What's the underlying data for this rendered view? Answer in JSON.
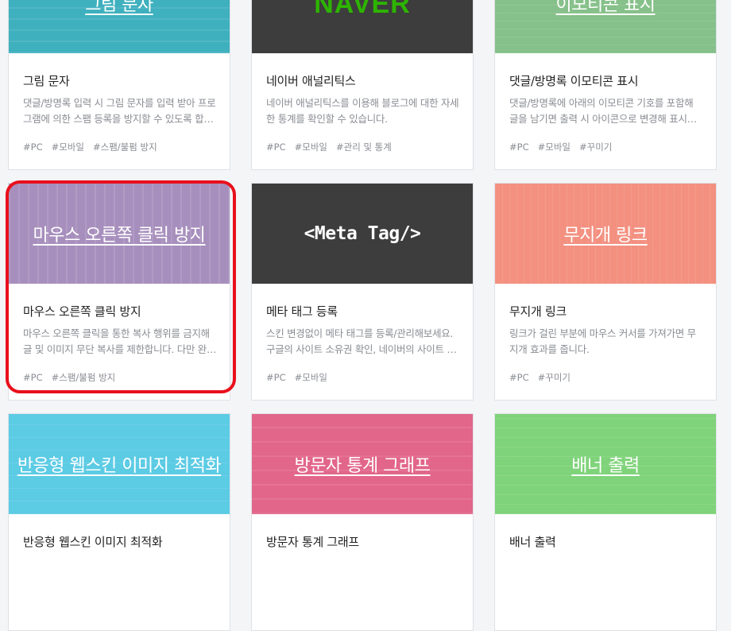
{
  "colors": {
    "highlight": "#e8101c",
    "naver_green": "#2db400"
  },
  "cards": [
    {
      "thumb_label": "그림 문자",
      "thumb_color": "#3fb0be",
      "title": "그림 문자",
      "desc": "댓글/방명록 입력 시 그림 문자를 입력 받아 프로그램에 의한 스팸 등록을 방지할 수 있도록 합니다.",
      "tags": [
        "#PC",
        "#모바일",
        "#스팸/불펌 방지"
      ]
    },
    {
      "thumb_label": "NAVER",
      "thumb_color": "#3d3d3d",
      "title": "네이버 애널리틱스",
      "desc": "네이버 애널리틱스를 이용해 블로그에 대한 자세한 통계를 확인할 수 있습니다.",
      "tags": [
        "#PC",
        "#모바일",
        "#관리 및 통계"
      ]
    },
    {
      "thumb_label": "이모티콘 표시",
      "thumb_color": "#86c08a",
      "title": "댓글/방명록 이모티콘 표시",
      "desc": "댓글/방명록에 아래의 이모티콘 기호를 포함해 글을 남기면 출력 시 아이콘으로 변경해 표시합니다.",
      "tags": [
        "#PC",
        "#모바일",
        "#꾸미기"
      ]
    },
    {
      "thumb_label": "마우스 오른쪽 클릭 방지",
      "thumb_color": "#a78fbd",
      "title": "마우스 오른쪽 클릭 방지",
      "desc": "마우스 오른쪽 클릭을 통한 복사 행위를 금지해 글 및 이미지 무단 복사를 제한합니다. 다만 완벽한 방지는 어렵습니다.",
      "tags": [
        "#PC",
        "#스팸/불펌 방지"
      ]
    },
    {
      "thumb_label": "<Meta Tag/>",
      "thumb_color": "#3d3d3d",
      "title": "메타 태그 등록",
      "desc": "스킨 변경없이 메타 태그를 등록/관리해보세요. 구글의 사이트 소유권 확인, 네이버의 사이트 등록에 사용할 수 있습니다.",
      "tags": [
        "#PC",
        "#모바일"
      ]
    },
    {
      "thumb_label": "무지개 링크",
      "thumb_color": "#f39080",
      "title": "무지개 링크",
      "desc": "링크가 걸린 부분에 마우스 커서를 가져가면 무지개 효과를 줍니다.",
      "tags": [
        "#PC",
        "#꾸미기"
      ]
    },
    {
      "thumb_label": "반응형 웹스킨 이미지 최적화",
      "thumb_color": "#5ccbe4",
      "title": "반응형 웹스킨 이미지 최적화",
      "desc": "",
      "tags": []
    },
    {
      "thumb_label": "방문자 통계 그래프",
      "thumb_color": "#e2668a",
      "title": "방문자 통계 그래프",
      "desc": "",
      "tags": []
    },
    {
      "thumb_label": "배너 출력",
      "thumb_color": "#7fd37a",
      "title": "배너 출력",
      "desc": "",
      "tags": []
    }
  ]
}
